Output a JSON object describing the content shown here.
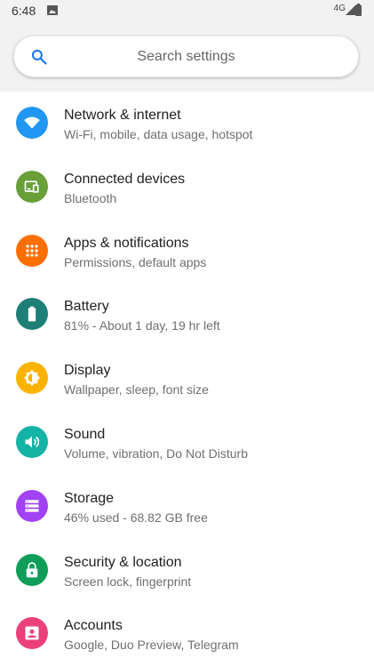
{
  "status_bar": {
    "time": "6:48",
    "network": "4G"
  },
  "search": {
    "placeholder": "Search settings"
  },
  "items": [
    {
      "title": "Network & internet",
      "subtitle": "Wi-Fi, mobile, data usage, hotspot",
      "icon": "wifi-icon",
      "color": "#2196f3"
    },
    {
      "title": "Connected devices",
      "subtitle": "Bluetooth",
      "icon": "devices-icon",
      "color": "#689f38"
    },
    {
      "title": "Apps & notifications",
      "subtitle": "Permissions, default apps",
      "icon": "apps-icon",
      "color": "#ff6f00"
    },
    {
      "title": "Battery",
      "subtitle": "81% - About 1 day, 19 hr left",
      "icon": "battery-icon",
      "color": "#1e7f76"
    },
    {
      "title": "Display",
      "subtitle": "Wallpaper, sleep, font size",
      "icon": "brightness-icon",
      "color": "#fbb300"
    },
    {
      "title": "Sound",
      "subtitle": "Volume, vibration, Do Not Disturb",
      "icon": "volume-icon",
      "color": "#14b3a6"
    },
    {
      "title": "Storage",
      "subtitle": "46% used - 68.82 GB free",
      "icon": "storage-icon",
      "color": "#a142f4"
    },
    {
      "title": "Security & location",
      "subtitle": "Screen lock, fingerprint",
      "icon": "lock-icon",
      "color": "#0f9d58"
    },
    {
      "title": "Accounts",
      "subtitle": "Google, Duo Preview, Telegram",
      "icon": "account-icon",
      "color": "#ec407a"
    }
  ]
}
